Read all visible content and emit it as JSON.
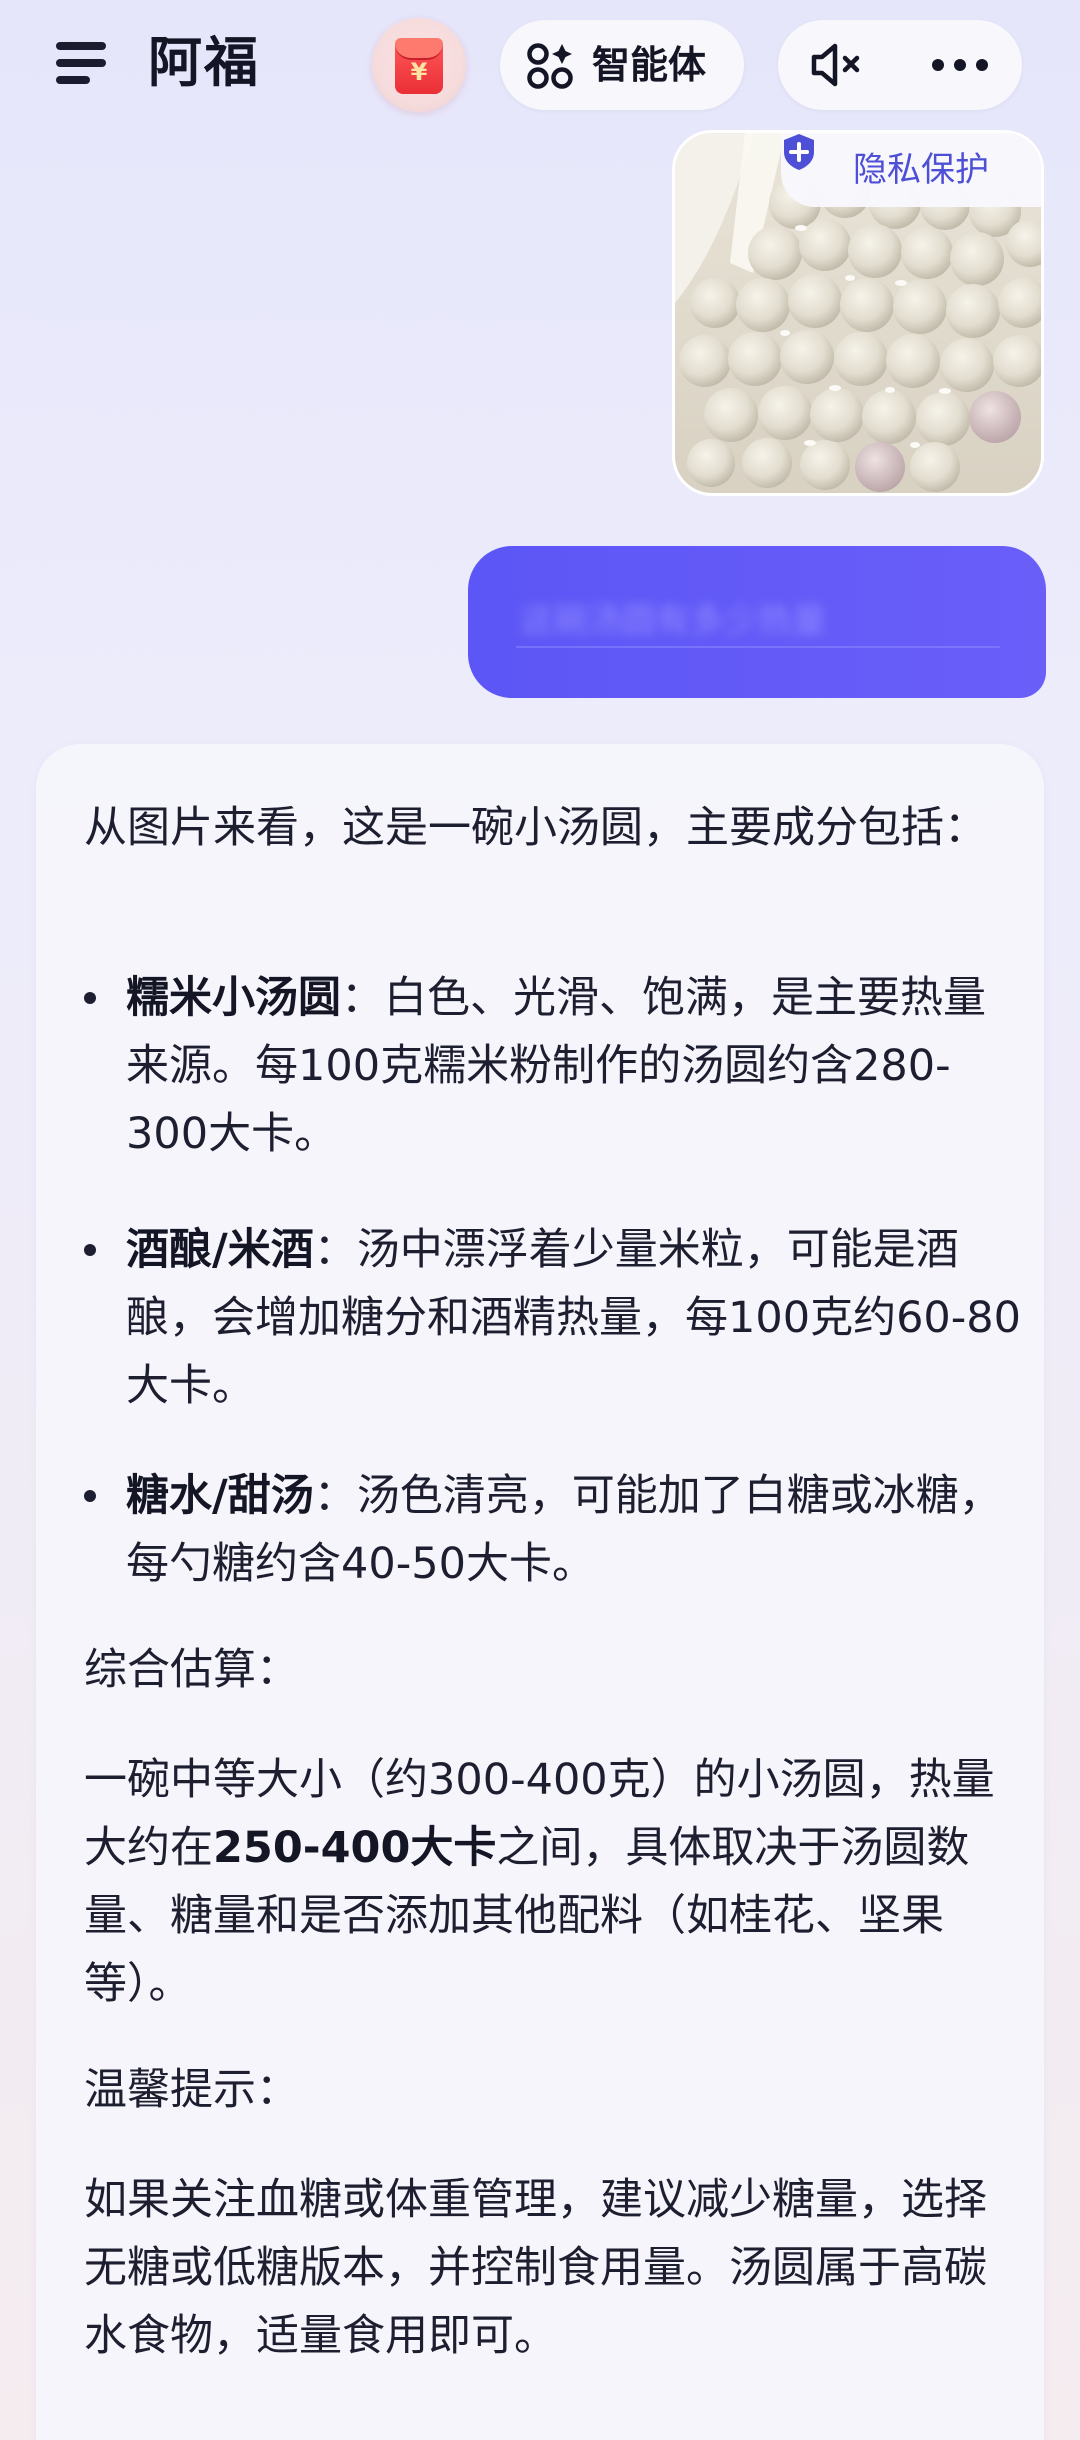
{
  "header": {
    "title": "阿福",
    "redpacket_symbol": "¥",
    "agent_label": "智能体",
    "icons": [
      "menu-icon",
      "red-packet-icon",
      "agent-grid-icon",
      "speaker-mute-icon",
      "more-dots-icon"
    ]
  },
  "user_message": {
    "photo_alt": "一碗小汤圆",
    "privacy_label": "隐私保护",
    "blurred_text": "这碗汤圆有多少热量"
  },
  "answer": {
    "intro": "从图片来看，这是一碗小汤圆，主要成分包括：",
    "items": [
      {
        "title": "糯米小汤圆",
        "sep": "：",
        "text": "白色、光滑、饱满，是主要热量来源。每100克糯米粉制作的汤圆约含280-300大卡。"
      },
      {
        "title": "酒酿/米酒",
        "sep": "：",
        "text": "汤中漂浮着少量米粒，可能是酒酿，会增加糖分和酒精热量，每100克约60-80大卡。"
      },
      {
        "title": "糖水/甜汤",
        "sep": "：",
        "text": "汤色清亮，可能加了白糖或冰糖，每勺糖约含40-50大卡。"
      }
    ],
    "summary_heading": "综合估算：",
    "summary_before": "一碗中等大小（约300-400克）的小汤圆，热量大约在",
    "summary_bold": "250-400大卡",
    "summary_after": "之间，具体取决于汤圆数量、糖量和是否添加其他配料（如桂花、坚果等）。",
    "tip_heading": "温馨提示：",
    "tip_text": "如果关注血糖或体重管理，建议减少糖量，选择无糖或低糖版本，并控制食用量。汤圆属于高碳水食物，适量食用即可。"
  },
  "colors": {
    "accent": "#5c56f6",
    "privacy": "#4d4fd6",
    "text": "#1d1f30"
  }
}
